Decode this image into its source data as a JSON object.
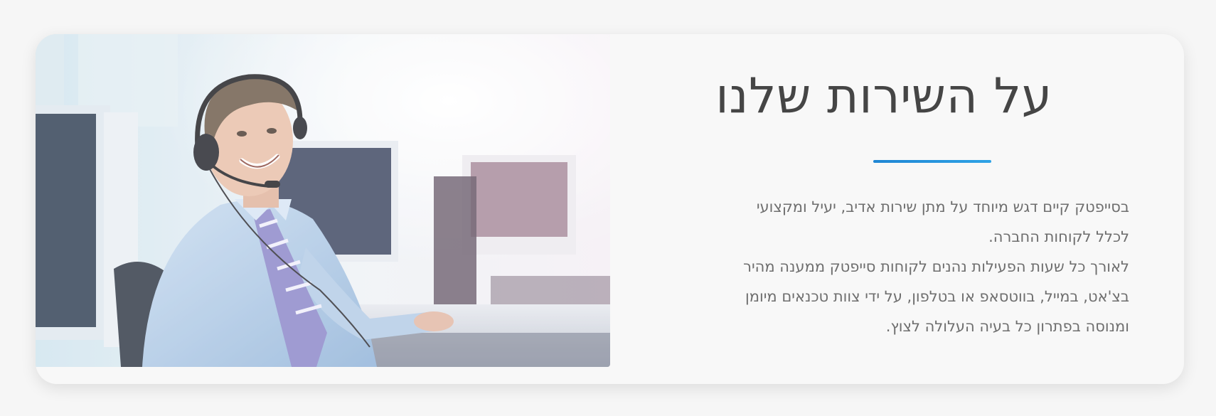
{
  "section": {
    "title": "על השירות שלנו",
    "paragraph_1": "בסייפטק קיים דגש מיוחד על מתן שירות אדיב, יעיל ומקצועי לכלל לקוחות החברה.",
    "paragraph_2": "לאורך כל שעות הפעילות נהנים לקוחות סייפטק ממענה מהיר בצ'אט, במייל, בווטסאפ או בטלפון, על ידי צוות טכנאים מיומן ומנוסה בפתרון כל בעיה העלולה לצוץ."
  },
  "colors": {
    "accent": "#1f86d4",
    "title": "#454545",
    "body_text": "#6e6e6e",
    "card_bg": "#f8f8f8"
  },
  "image": {
    "subject": "customer-support-agent-with-headset"
  }
}
